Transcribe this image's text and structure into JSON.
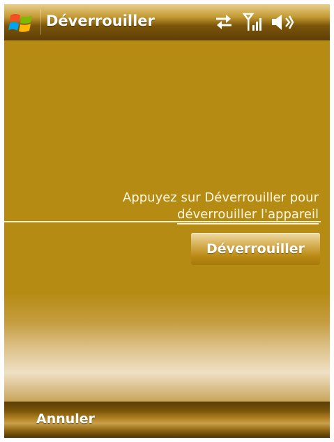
{
  "titlebar": {
    "start_icon": "windows-flag-icon",
    "title": "Déverrouiller",
    "status_icons": [
      "sync-arrows-icon",
      "signal-strength-icon",
      "volume-icon"
    ]
  },
  "content": {
    "prompt_line1": "Appuyez sur Déverrouiller pour",
    "prompt_line2": "déverrouiller l'appareil",
    "unlock_button_label": "Déverrouiller"
  },
  "softkeys": {
    "left_label": "Annuler"
  },
  "colors": {
    "background": "#b58a12",
    "text": "#ffffff"
  }
}
